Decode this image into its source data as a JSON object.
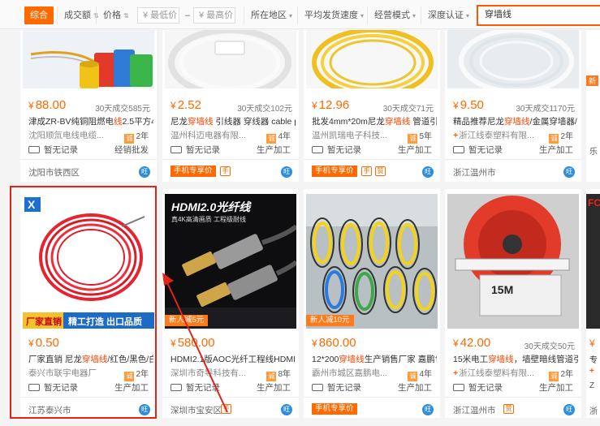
{
  "filter": {
    "sort_all": "综合",
    "sort_volume": "成交额",
    "sort_price": "价格",
    "price_min_placeholder": "¥ 最低价",
    "price_dash": "–",
    "price_max_placeholder": "¥ 最高价",
    "region": "所在地区",
    "ship_speed": "平均发货速度",
    "biz_mode": "经营模式",
    "certification": "深度认证",
    "search_value": "穿墙线"
  },
  "colors": {
    "accent": "#ff6a00",
    "highlight": "#ff4400",
    "annotation": "#e2231a"
  },
  "products": [
    {
      "price_cur": "¥",
      "price": "88.00",
      "sold": "30天成交585元",
      "title_pre": "津成ZR-BV纯铜阻燃电",
      "title_hl": "线",
      "title_post": "2.5平方4平...",
      "shop": "沈阳顺氚电线电缆...",
      "years": "2年",
      "year_icon": "诚",
      "record": "暂无记录",
      "mode": "经销批发",
      "location": "沈阳市铁西区"
    },
    {
      "price_cur": "¥",
      "price": "2.52",
      "sold": "30天成交102元",
      "title_pre": "尼龙",
      "title_hl": "穿墙线",
      "title_post": " 引线器 穿线器 cable pu...",
      "shop": "温州科迈电器有限...",
      "years": "4年",
      "year_icon": "诚",
      "record": "暂无记录",
      "mode": "生产加工",
      "mobile_tag": "手机专享价",
      "location": ""
    },
    {
      "price_cur": "¥",
      "price": "12.96",
      "sold": "30天成交71元",
      "title_pre": "批发4mm*20m尼龙",
      "title_hl": "穿墙线",
      "title_post": " 管道引...",
      "shop": "温州凯瑞电子科技...",
      "years": "5年",
      "year_icon": "诚",
      "record": "暂无记录",
      "mode": "生产加工",
      "mobile_tag": "手机专享价",
      "location": ""
    },
    {
      "price_cur": "¥",
      "price": "9.50",
      "sold": "30天成交1170元",
      "title_pre": "精品推荐尼龙",
      "title_hl": "穿墙线",
      "title_post": "/金属穿墙器/电...",
      "shop": "浙江线泰塑料有限...",
      "years": "2年",
      "year_icon": "诚",
      "record": "暂无记录",
      "mode": "生产加工",
      "location": "浙江温州市"
    },
    {
      "price_cur": "¥",
      "price": "0.50",
      "sold": "",
      "title_pre": "厂家直销 尼龙",
      "title_hl": "穿墙线",
      "title_post": "/红色/黑色/白...",
      "shop": "泰兴市联宇电器厂",
      "years": "2年",
      "year_icon": "诚",
      "record": "暂无记录",
      "mode": "生产加工",
      "location": "江苏泰兴市",
      "banner_left": "厂家直销",
      "banner_right": "精工打造 出口品质"
    },
    {
      "price_cur": "¥",
      "price": "580.00",
      "sold": "",
      "title_pre": "HDMI2.1版AOC光纤工程线HDMI",
      "title_hl": "穿",
      "title_post": "...",
      "shop": "深圳市奇导科技有...",
      "years": "8年",
      "year_icon": "诚",
      "record": "暂无记录",
      "mode": "生产加工",
      "location": "深圳市宝安区",
      "promo": "新人减5元",
      "img_text": "HDMI2.0光纤线",
      "img_sub": "真4K高清画质 工程级耐线"
    },
    {
      "price_cur": "¥",
      "price": "860.00",
      "sold": "",
      "title_pre": "12*200",
      "title_hl": "穿墙线",
      "title_post": "生产销售厂家 嘉鹏包...",
      "shop": "霸州市城区嘉鹏电...",
      "years": "4年",
      "year_icon": "诚",
      "record": "暂无记录",
      "mode": "生产加工",
      "mobile_tag": "手机专享价",
      "location": "",
      "promo": "新人减10元"
    },
    {
      "price_cur": "¥",
      "price": "42.00",
      "sold": "30天成交50元",
      "title_pre": "15米电工",
      "title_hl": "穿墙线",
      "title_post": "，墙壁暗线管道引...",
      "shop": "浙江线泰塑料有限...",
      "years": "2年",
      "year_icon": "诚",
      "record": "暂无记录",
      "mode": "生产加工",
      "location": "浙江温州市",
      "img_text": "15M"
    }
  ],
  "partial_col": {
    "top_badge": "新",
    "loc1": "乐",
    "price": "¥",
    "title": "专",
    "shop": "+",
    "year": "Z",
    "loc2": "浙",
    "img_text": "FC"
  },
  "common": {
    "wangwang": "旺",
    "mobile_icon": "手",
    "zan_icon": "赞"
  }
}
